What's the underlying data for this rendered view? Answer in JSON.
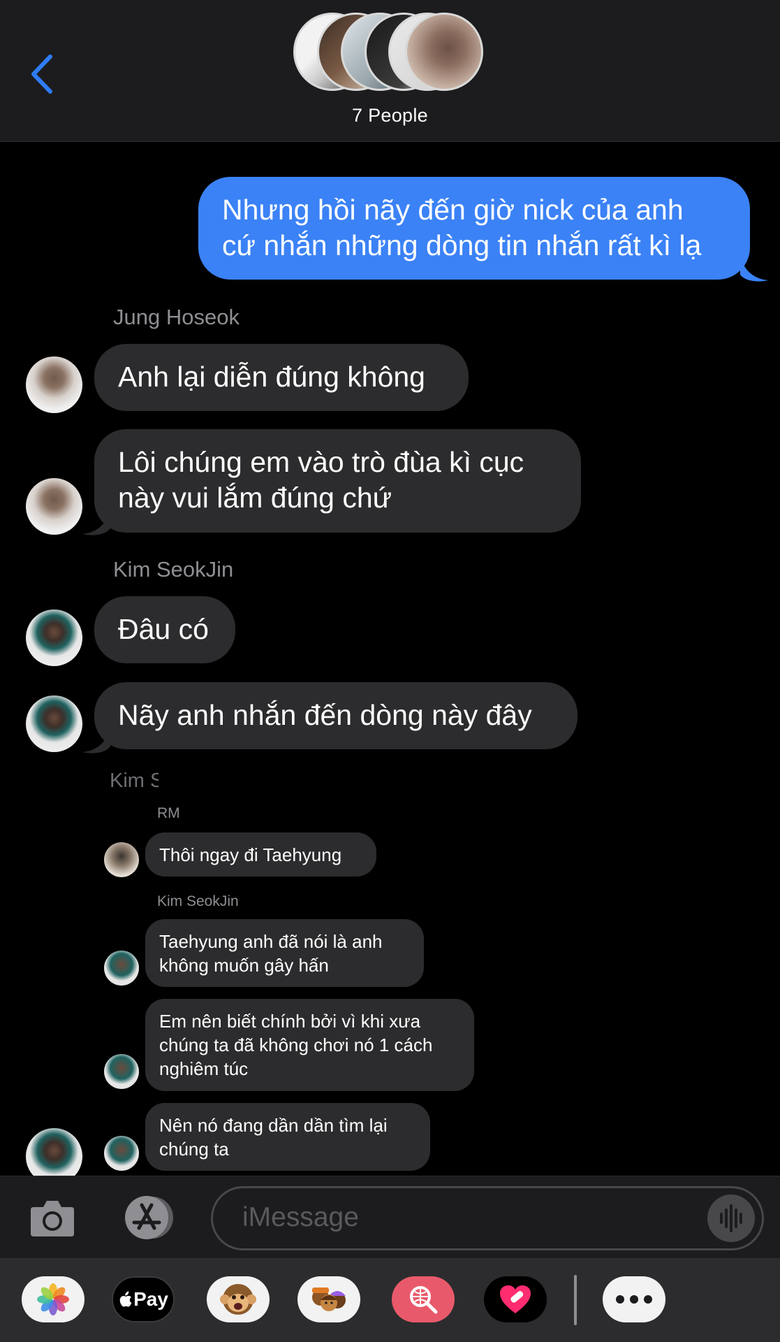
{
  "header": {
    "back_icon": "chevron-left-icon",
    "title": "7 People"
  },
  "messages": [
    {
      "type": "sent",
      "text_l1": "Nhưng hồi nãy đến giờ nick của anh",
      "text_l2": "cứ nhắn những dòng tin nhắn rất kì lạ"
    },
    {
      "sender": "Jung Hoseok"
    },
    {
      "type": "received",
      "text": "Anh lại diễn đúng không"
    },
    {
      "type": "received",
      "text_l1": "Lôi chúng em vào trò đùa kì cục",
      "text_l2": "này vui lắm đúng chứ"
    },
    {
      "sender": "Kim SeokJin"
    },
    {
      "type": "received",
      "text": "Đâu có"
    },
    {
      "type": "received",
      "text": "Nãy anh nhắn đến dòng này đây"
    },
    {
      "sender_partial": "Kim S"
    }
  ],
  "nested": {
    "sender_rm": "RM",
    "msg_rm": "Thôi ngay đi Taehyung",
    "sender_jin": "Kim SeokJin",
    "msg1_l1": "Taehyung anh đã nói là anh",
    "msg1_l2": "không muốn gây hấn",
    "msg2_l1": "Em nên biết chính bởi vì khi xưa",
    "msg2_l2": "chúng ta đã không chơi nó 1 cách",
    "msg2_l3": "nghiêm túc",
    "msg3_l1": "Nên nó đang dần dần tìm lại",
    "msg3_l2": "chúng ta"
  },
  "input": {
    "placeholder": "iMessage",
    "camera_icon": "camera-icon",
    "appstore_icon": "app-store-icon",
    "mic_icon": "audio-waveform-icon"
  },
  "apps": {
    "pay_label": "Pay",
    "items": [
      "photos-icon",
      "apple-pay-icon",
      "animoji-icon",
      "memoji-icon",
      "image-search-icon",
      "digital-touch-icon",
      "more-icon"
    ]
  },
  "colors": {
    "sent_bubble": "#3b82f6",
    "received_bubble": "#2c2c2e",
    "background": "#000000",
    "accent": "#2f7cf6"
  }
}
